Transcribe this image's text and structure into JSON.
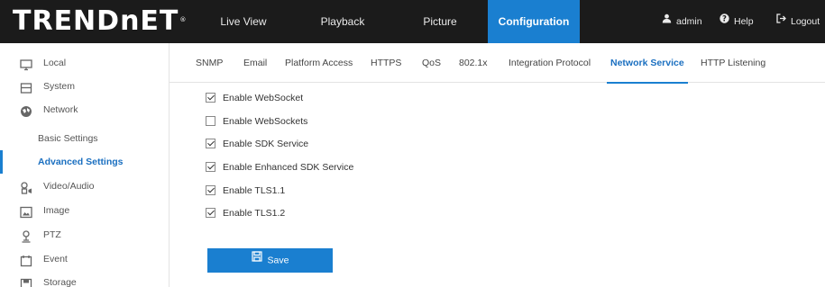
{
  "brand": {
    "logo_text": "TRENDnET",
    "registered_mark": "®"
  },
  "nav": {
    "items": [
      {
        "label": "Live View",
        "active": false
      },
      {
        "label": "Playback",
        "active": false
      },
      {
        "label": "Picture",
        "active": false
      },
      {
        "label": "Configuration",
        "active": true
      }
    ]
  },
  "user_menu": {
    "user": {
      "icon": "user-icon",
      "label": "admin"
    },
    "help": {
      "icon": "help-icon",
      "label": "Help"
    },
    "logout": {
      "icon": "logout-icon",
      "label": "Logout"
    }
  },
  "sidebar": {
    "items": [
      {
        "icon": "monitor-icon",
        "label": "Local"
      },
      {
        "icon": "system-icon",
        "label": "System"
      },
      {
        "icon": "network-icon",
        "label": "Network"
      },
      {
        "label": "Basic Settings",
        "sub": true,
        "active": false
      },
      {
        "label": "Advanced Settings",
        "sub": true,
        "active": true
      },
      {
        "icon": "video-audio-icon",
        "label": "Video/Audio"
      },
      {
        "icon": "image-icon",
        "label": "Image"
      },
      {
        "icon": "ptz-icon",
        "label": "PTZ"
      },
      {
        "icon": "event-icon",
        "label": "Event"
      },
      {
        "icon": "storage-icon",
        "label": "Storage"
      }
    ]
  },
  "tabs": {
    "items": [
      {
        "label": "SNMP",
        "active": false
      },
      {
        "label": "Email",
        "active": false
      },
      {
        "label": "Platform Access",
        "active": false
      },
      {
        "label": "HTTPS",
        "active": false
      },
      {
        "label": "QoS",
        "active": false
      },
      {
        "label": "802.1x",
        "active": false
      },
      {
        "label": "Integration Protocol",
        "active": false
      },
      {
        "label": "Network Service",
        "active": true
      },
      {
        "label": "HTTP Listening",
        "active": false
      }
    ]
  },
  "options": [
    {
      "label": "Enable WebSocket",
      "checked": true
    },
    {
      "label": "Enable WebSockets",
      "checked": false
    },
    {
      "label": "Enable SDK Service",
      "checked": true
    },
    {
      "label": "Enable Enhanced SDK Service",
      "checked": true
    },
    {
      "label": "Enable TLS1.1",
      "checked": true
    },
    {
      "label": "Enable TLS1.2",
      "checked": true
    }
  ],
  "save": {
    "icon": "save-icon",
    "label": "Save"
  },
  "colors": {
    "topbar": "#1b1b1b",
    "accent": "#1a7fd0",
    "active_text": "#1a6fc0"
  }
}
